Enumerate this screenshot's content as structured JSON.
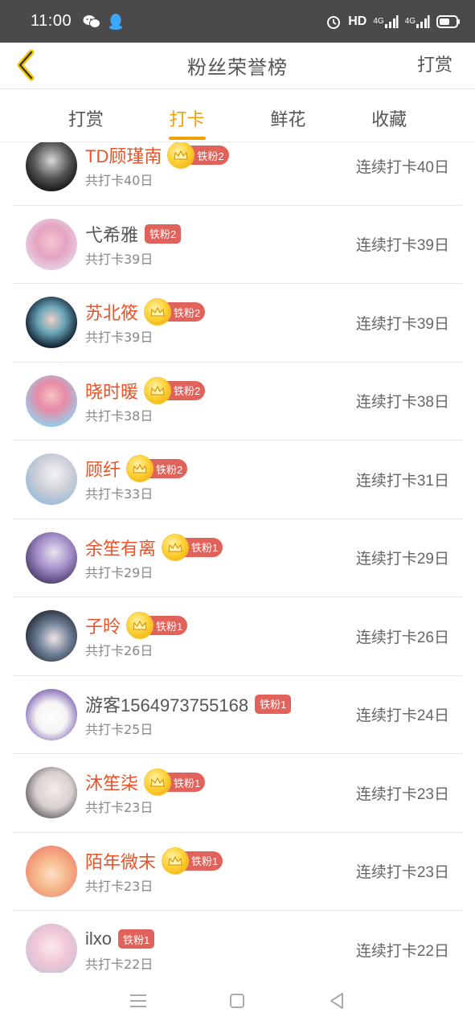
{
  "status_bar": {
    "time": "11:00",
    "network": "HD",
    "signal1": "4G",
    "signal2": "4G"
  },
  "header": {
    "title": "粉丝荣誉榜",
    "action": "打赏"
  },
  "tabs": [
    {
      "label": "打赏"
    },
    {
      "label": "打卡"
    },
    {
      "label": "鲜花"
    },
    {
      "label": "收藏"
    }
  ],
  "colors": {
    "accent": "#f0a000",
    "vip_name": "#e8532a",
    "badge": "#e0625a"
  },
  "fans": [
    {
      "name": "TD顾瑾南",
      "badge": "铁粉2",
      "total": "共打卡40日",
      "streak": "连续打卡40日",
      "vip": true
    },
    {
      "name": "弋希雅",
      "badge": "铁粉2",
      "total": "共打卡39日",
      "streak": "连续打卡39日",
      "vip": false
    },
    {
      "name": "苏北筱",
      "badge": "铁粉2",
      "total": "共打卡39日",
      "streak": "连续打卡39日",
      "vip": true
    },
    {
      "name": "晓时暖",
      "badge": "铁粉2",
      "total": "共打卡38日",
      "streak": "连续打卡38日",
      "vip": true
    },
    {
      "name": "顾纤",
      "badge": "铁粉2",
      "total": "共打卡33日",
      "streak": "连续打卡31日",
      "vip": true
    },
    {
      "name": "余笙有离",
      "badge": "铁粉1",
      "total": "共打卡29日",
      "streak": "连续打卡29日",
      "vip": true
    },
    {
      "name": "子昤",
      "badge": "铁粉1",
      "total": "共打卡26日",
      "streak": "连续打卡26日",
      "vip": true
    },
    {
      "name": "游客1564973755168",
      "badge": "铁粉1",
      "total": "共打卡25日",
      "streak": "连续打卡24日",
      "vip": false
    },
    {
      "name": "沐笙柒",
      "badge": "铁粉1",
      "total": "共打卡23日",
      "streak": "连续打卡23日",
      "vip": true
    },
    {
      "name": "陌年微末",
      "badge": "铁粉1",
      "total": "共打卡23日",
      "streak": "连续打卡23日",
      "vip": true
    },
    {
      "name": "ilxo",
      "badge": "铁粉1",
      "total": "共打卡22日",
      "streak": "连续打卡22日",
      "vip": false
    }
  ]
}
